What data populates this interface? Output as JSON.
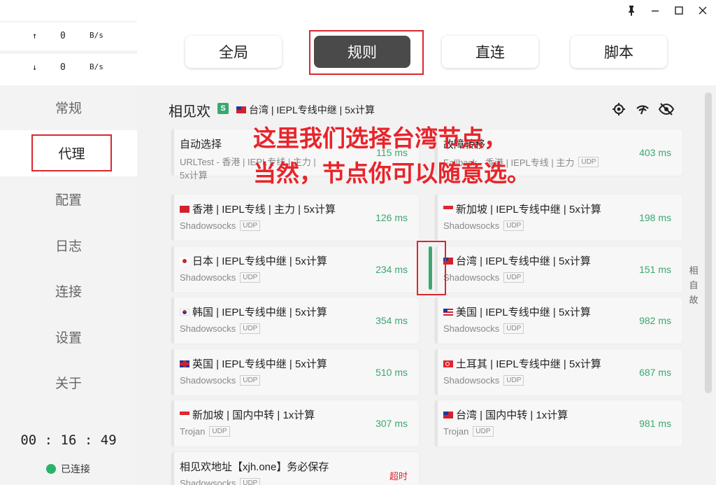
{
  "window": {
    "pin_icon": "pin-icon",
    "minimize_icon": "minimize-icon",
    "maximize_icon": "maximize-icon",
    "close_icon": "close-icon"
  },
  "speed": {
    "up_arrow": "↑",
    "up_value": "0",
    "up_unit": "B/s",
    "down_arrow": "↓",
    "down_value": "0",
    "down_unit": "B/s"
  },
  "sidebar": {
    "items": [
      {
        "label": "常规"
      },
      {
        "label": "代理"
      },
      {
        "label": "配置"
      },
      {
        "label": "日志"
      },
      {
        "label": "连接"
      },
      {
        "label": "设置"
      },
      {
        "label": "关于"
      }
    ],
    "timer": "00 : 16 : 49",
    "status": "已连接",
    "status_color": "#2bb36a"
  },
  "modes": {
    "global": "全局",
    "rule": "规则",
    "direct": "直连",
    "script": "脚本",
    "selected": "规则"
  },
  "group": {
    "title": "相见欢",
    "badge": "S",
    "current": "台湾 | IEPL专线中继 | 5x计算"
  },
  "side_letters": [
    "相",
    "自",
    "故"
  ],
  "annotation": {
    "line1": "这里我们选择台湾节点，",
    "line2": "当然，节点你可以随意选。"
  },
  "proxies": [
    {
      "name": "自动选择",
      "type": "URLTest - 香港 | IEPL专线 | 主力 |",
      "type2": "5x计算",
      "delay": "115 ms",
      "udp": ""
    },
    {
      "name": "故障转移",
      "type": "Fallback - 香港 | IEPL专线 | 主力",
      "type2": "",
      "delay": "403 ms",
      "udp": "UDP"
    },
    {
      "name": "香港 | IEPL专线 | 主力 | 5x计算",
      "type": "Shadowsocks",
      "delay": "126 ms",
      "udp": "UDP"
    },
    {
      "name": "新加坡 | IEPL专线中继 | 5x计算",
      "type": "Shadowsocks",
      "delay": "198 ms",
      "udp": "UDP"
    },
    {
      "name": "日本 | IEPL专线中继 | 5x计算",
      "type": "Shadowsocks",
      "delay": "234 ms",
      "udp": "UDP"
    },
    {
      "name": "台湾 | IEPL专线中继 | 5x计算",
      "type": "Shadowsocks",
      "delay": "151 ms",
      "udp": "UDP"
    },
    {
      "name": "韩国 | IEPL专线中继 | 5x计算",
      "type": "Shadowsocks",
      "delay": "354 ms",
      "udp": "UDP"
    },
    {
      "name": "美国 | IEPL专线中继 | 5x计算",
      "type": "Shadowsocks",
      "delay": "982 ms",
      "udp": "UDP"
    },
    {
      "name": "英国 | IEPL专线中继 | 5x计算",
      "type": "Shadowsocks",
      "delay": "510 ms",
      "udp": "UDP"
    },
    {
      "name": "土耳其 | IEPL专线中继 | 5x计算",
      "type": "Shadowsocks",
      "delay": "687 ms",
      "udp": "UDP"
    },
    {
      "name": "新加坡 | 国内中转 | 1x计算",
      "type": "Trojan",
      "delay": "307 ms",
      "udp": "UDP"
    },
    {
      "name": "台湾 | 国内中转 | 1x计算",
      "type": "Trojan",
      "delay": "981 ms",
      "udp": "UDP"
    },
    {
      "name": "相见欢地址【xjh.one】务必保存",
      "type": "Shadowsocks",
      "delay": "超时",
      "udp": "UDP"
    }
  ],
  "colors": {
    "accent": "#3aa870",
    "highlight_red": "#d9272e",
    "selected_mode_bg": "#4a4a4a"
  }
}
